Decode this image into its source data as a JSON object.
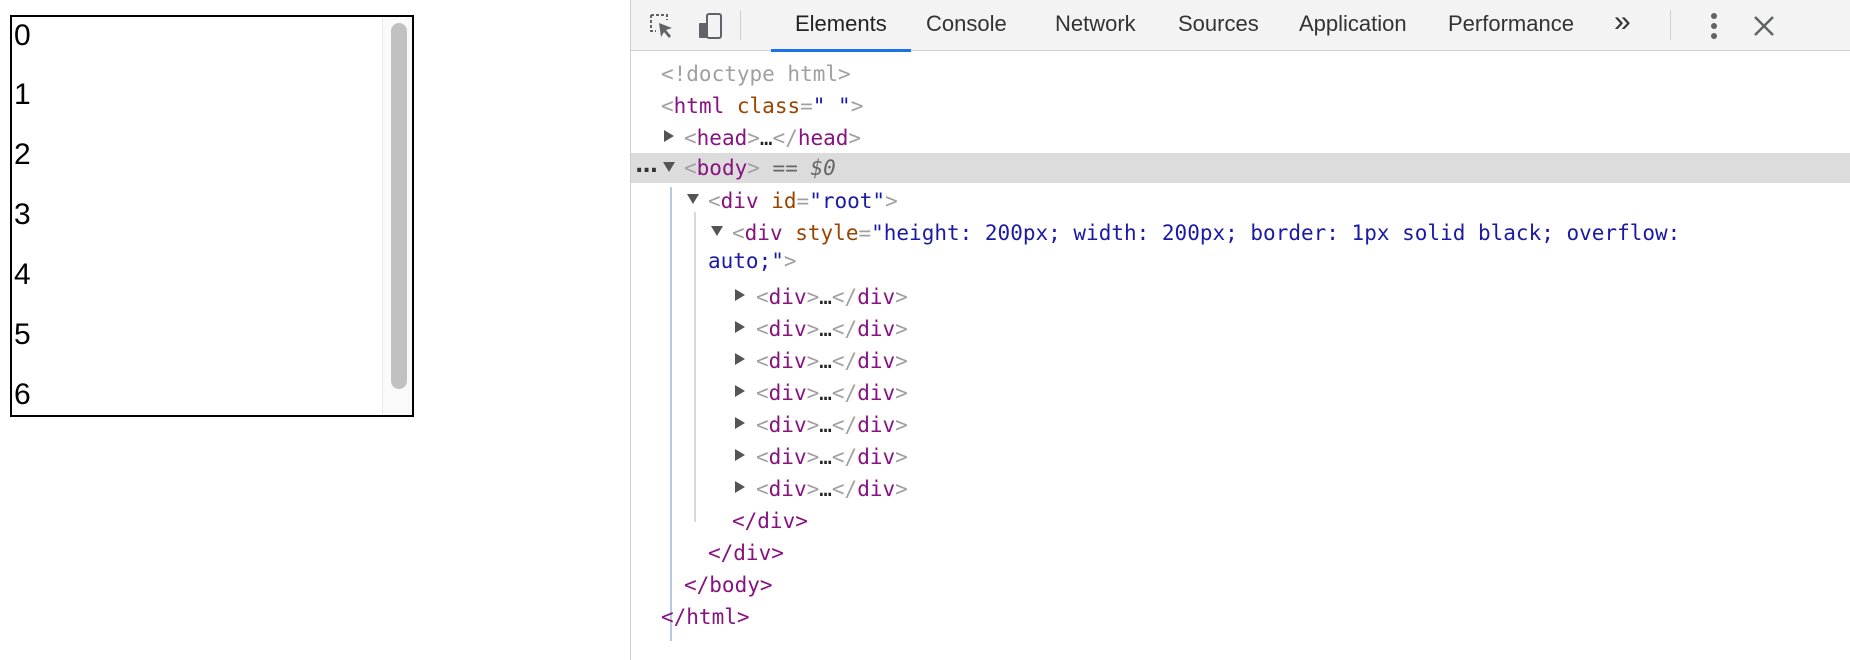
{
  "preview": {
    "numbers": [
      "0",
      "1",
      "2",
      "3",
      "4",
      "5",
      "6"
    ]
  },
  "devtools": {
    "tabs": [
      {
        "label": "Elements",
        "active": true
      },
      {
        "label": "Console",
        "active": false
      },
      {
        "label": "Network",
        "active": false
      },
      {
        "label": "Sources",
        "active": false
      },
      {
        "label": "Application",
        "active": false
      },
      {
        "label": "Performance",
        "active": false
      }
    ],
    "more_tabs_label": "»",
    "icons": {
      "inspect": "cursor-select-icon",
      "device": "device-toggle-icon",
      "more": "kebab-menu-icon",
      "close": "close-icon"
    },
    "accent": "#1a73e8",
    "selected_row_bg": "#dcdcdc"
  },
  "tree": {
    "doctype": "<!doctype html>",
    "html_open_tag": "html",
    "html_attr_name": "class",
    "html_attr_value": "\" \"",
    "head_tag": "head",
    "head_ellipsis": "…",
    "body_tag": "body",
    "body_marker": "== $0",
    "root_tag": "div",
    "root_attr_name": "id",
    "root_attr_value": "\"root\"",
    "style_div_tag": "div",
    "style_attr_name": "style",
    "style_value_line1": "\"height: 200px; width: 200px; border: 1px solid black; overflow:",
    "style_value_line2": "auto;\"",
    "child_tag": "div",
    "child_ellipsis": "…",
    "child_count_rows": [
      "div",
      "div",
      "div",
      "div",
      "div",
      "div",
      "div"
    ],
    "close_div_inner": "</div>",
    "close_div_outer": "</div>",
    "close_body": "</body>",
    "close_html": "</html>",
    "row_ellipsis": "..."
  }
}
